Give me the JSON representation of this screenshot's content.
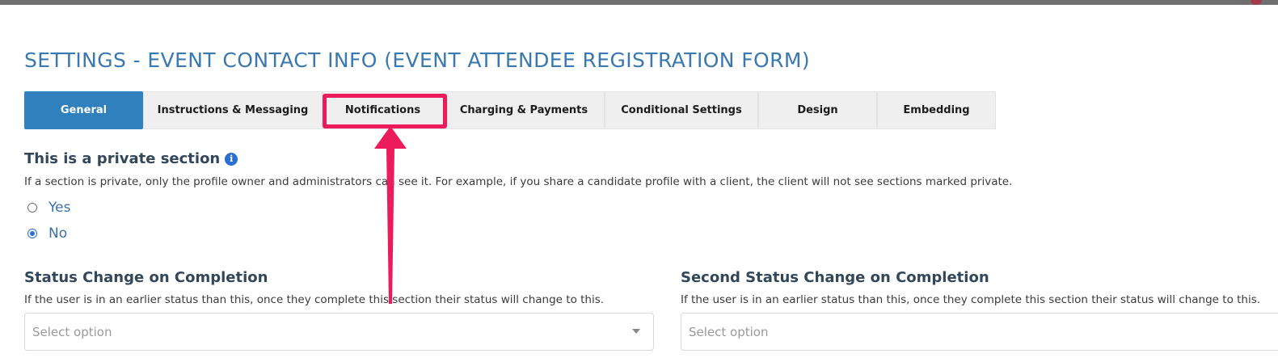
{
  "page": {
    "title": "SETTINGS - EVENT CONTACT INFO (EVENT ATTENDEE REGISTRATION FORM)"
  },
  "tabs": [
    {
      "label": "General",
      "active": true
    },
    {
      "label": "Instructions & Messaging",
      "active": false
    },
    {
      "label": "Notifications",
      "active": false,
      "highlighted": true
    },
    {
      "label": "Charging & Payments",
      "active": false
    },
    {
      "label": "Conditional Settings",
      "active": false
    },
    {
      "label": "Design",
      "active": false
    },
    {
      "label": "Embedding",
      "active": false
    }
  ],
  "private_section": {
    "heading": "This is a private section",
    "info_icon": "info-icon",
    "help": "If a section is private, only the profile owner and administrators can see it. For example, if you share a candidate profile with a client, the client will not see sections marked private.",
    "options": [
      {
        "label": "Yes",
        "checked": false
      },
      {
        "label": "No",
        "checked": true
      }
    ]
  },
  "status_change": {
    "heading": "Status Change on Completion",
    "help": "If the user is in an earlier status than this, once they complete this section their status will change to this.",
    "placeholder": "Select option"
  },
  "second_status_change": {
    "heading": "Second Status Change on Completion",
    "help": "If the user is in an earlier status than this, once they complete this section their status will change to this.",
    "placeholder": "Select option"
  },
  "colors": {
    "accent": "#2f80bd",
    "title": "#3a78b0",
    "annotation": "#ec1c5c"
  }
}
